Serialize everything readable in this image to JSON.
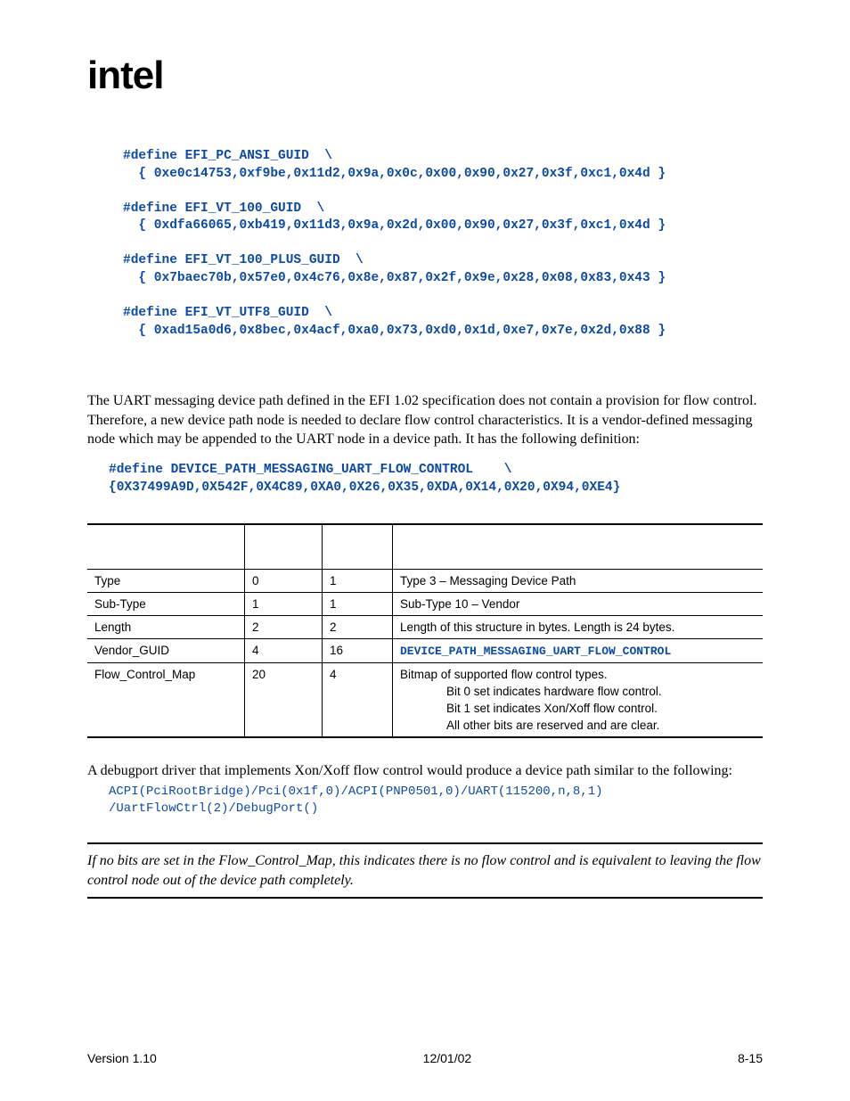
{
  "logo_text": "intel",
  "code1": "#define EFI_PC_ANSI_GUID  \\\n  { 0xe0c14753,0xf9be,0x11d2,0x9a,0x0c,0x00,0x90,0x27,0x3f,0xc1,0x4d }\n\n#define EFI_VT_100_GUID  \\\n  { 0xdfa66065,0xb419,0x11d3,0x9a,0x2d,0x00,0x90,0x27,0x3f,0xc1,0x4d }\n\n#define EFI_VT_100_PLUS_GUID  \\\n  { 0x7baec70b,0x57e0,0x4c76,0x8e,0x87,0x2f,0x9e,0x28,0x08,0x83,0x43 }\n\n#define EFI_VT_UTF8_GUID  \\\n  { 0xad15a0d6,0x8bec,0x4acf,0xa0,0x73,0xd0,0x1d,0xe7,0x7e,0x2d,0x88 }",
  "para1": "The UART messaging device path defined in the EFI 1.02 specification does not contain a provision for flow control.  Therefore, a new device path node is needed to declare flow control characteristics.  It is a vendor-defined messaging node which may be appended to the UART node in a device path.  It has the following definition:",
  "code2": "#define DEVICE_PATH_MESSAGING_UART_FLOW_CONTROL    \\\n{0X37499A9D,0X542F,0X4C89,0XA0,0X26,0X35,0XDA,0X14,0X20,0X94,0XE4}",
  "table": {
    "rows": [
      {
        "c0": "Type",
        "c1": "0",
        "c2": "1",
        "c3": "Type 3 – Messaging Device Path"
      },
      {
        "c0": "Sub-Type",
        "c1": "1",
        "c2": "1",
        "c3": "Sub-Type 10 – Vendor"
      },
      {
        "c0": "Length",
        "c1": "2",
        "c2": "2",
        "c3": "Length of this structure in bytes.  Length is 24 bytes."
      },
      {
        "c0": "Vendor_GUID",
        "c1": "4",
        "c2": "16",
        "c3_code": "DEVICE_PATH_MESSAGING_UART_FLOW_CONTROL"
      },
      {
        "c0": "Flow_Control_Map",
        "c1": "20",
        "c2": "4",
        "c3_lines": [
          "Bitmap of supported flow control types.",
          "Bit 0 set indicates hardware flow control.",
          "Bit 1 set indicates Xon/Xoff flow control.",
          "All other bits are reserved and are clear."
        ]
      }
    ]
  },
  "para2": "A debugport driver that implements Xon/Xoff flow control would produce a device path similar to the following:",
  "code3": "ACPI(PciRootBridge)/Pci(0x1f,0)/ACPI(PNP0501,0)/UART(115200,n,8,1)\n/UartFlowCtrl(2)/DebugPort()",
  "note": "If no bits are set in the Flow_Control_Map, this indicates there is no flow control and is equivalent to leaving the flow control node out of the device path completely.",
  "footer": {
    "left": "Version 1.10",
    "center": "12/01/02",
    "right": "8-15"
  }
}
